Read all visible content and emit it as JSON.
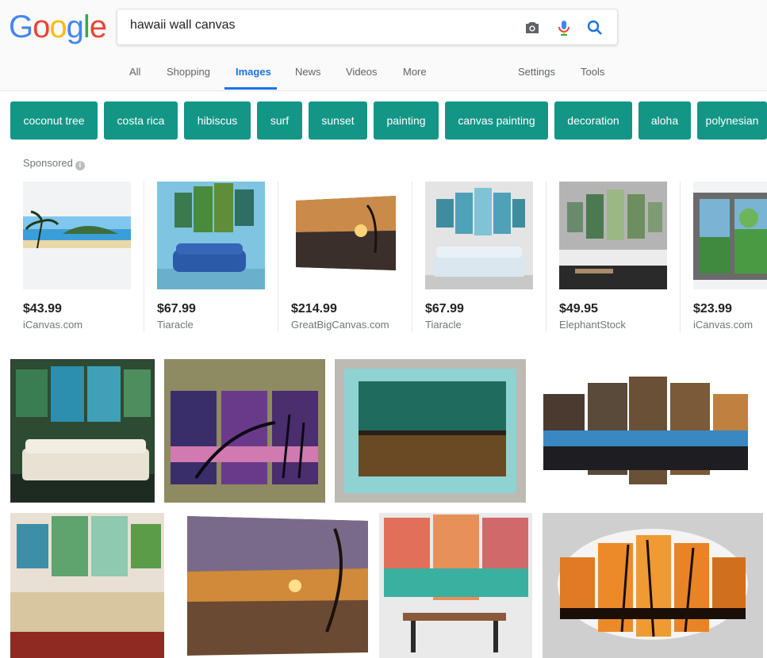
{
  "logo": [
    "G",
    "o",
    "o",
    "g",
    "l",
    "e"
  ],
  "search": {
    "query": "hawaii wall canvas"
  },
  "tabs": {
    "all": "All",
    "shopping": "Shopping",
    "images": "Images",
    "news": "News",
    "videos": "Videos",
    "more": "More",
    "settings": "Settings",
    "tools": "Tools"
  },
  "chips": [
    "coconut tree",
    "costa rica",
    "hibiscus",
    "surf",
    "sunset",
    "painting",
    "canvas painting",
    "decoration",
    "aloha",
    "polynesian"
  ],
  "sponsored_label": "Sponsored",
  "products": [
    {
      "price": "$43.99",
      "store": "iCanvas.com"
    },
    {
      "price": "$67.99",
      "store": "Tiaracle"
    },
    {
      "price": "$214.99",
      "store": "GreatBigCanvas.com"
    },
    {
      "price": "$67.99",
      "store": "Tiaracle"
    },
    {
      "price": "$49.95",
      "store": "ElephantStock"
    },
    {
      "price": "$23.99",
      "store": "iCanvas.com"
    }
  ],
  "colors": {
    "chip": "#139686",
    "accent": "#1a73e8"
  }
}
